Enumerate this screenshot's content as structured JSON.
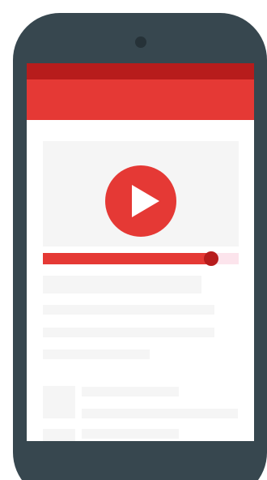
{
  "colors": {
    "phone_body": "#37474f",
    "camera": "#263238",
    "status_bar": "#b71c1c",
    "app_bar": "#e53935",
    "accent": "#e53935",
    "progress_track": "#fce4ec",
    "placeholder": "#f5f5f5"
  },
  "icons": {
    "play": "play-icon",
    "camera": "camera-icon"
  },
  "video": {
    "progress_fraction": 0.86
  }
}
